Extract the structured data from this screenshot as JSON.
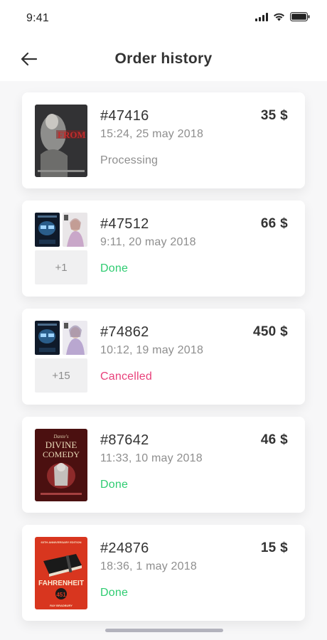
{
  "status_bar": {
    "time": "9:41"
  },
  "header": {
    "title": "Order history"
  },
  "orders": [
    {
      "id": "#47416",
      "datetime": "15:24, 25 may 2018",
      "status": "Processing",
      "price": "35 $",
      "status_color": "#8e8e8e",
      "more": ""
    },
    {
      "id": "#47512",
      "datetime": "9:11, 20 may 2018",
      "status": "Done",
      "price": "66 $",
      "status_color": "#2ecc71",
      "more": "+1"
    },
    {
      "id": "#74862",
      "datetime": "10:12, 19 may 2018",
      "status": "Cancelled",
      "price": "450 $",
      "status_color": "#e8407a",
      "more": "+15"
    },
    {
      "id": "#87642",
      "datetime": "11:33, 10 may 2018",
      "status": "Done",
      "price": "46 $",
      "status_color": "#2ecc71",
      "more": ""
    },
    {
      "id": "#24876",
      "datetime": "18:36, 1 may 2018",
      "status": "Done",
      "price": "15 $",
      "status_color": "#2ecc71",
      "more": ""
    }
  ],
  "covers": {
    "from_hell": {
      "text": "FROM HELL"
    },
    "divine_comedy": {
      "line1": "Dante's",
      "line2": "DIVINE",
      "line3": "COMEDY"
    },
    "fahrenheit": {
      "top": "60TH ANNIVERSARY EDITION",
      "title": "FAHRENHEIT",
      "number": "451",
      "author": "RAY BRADBURY"
    }
  }
}
